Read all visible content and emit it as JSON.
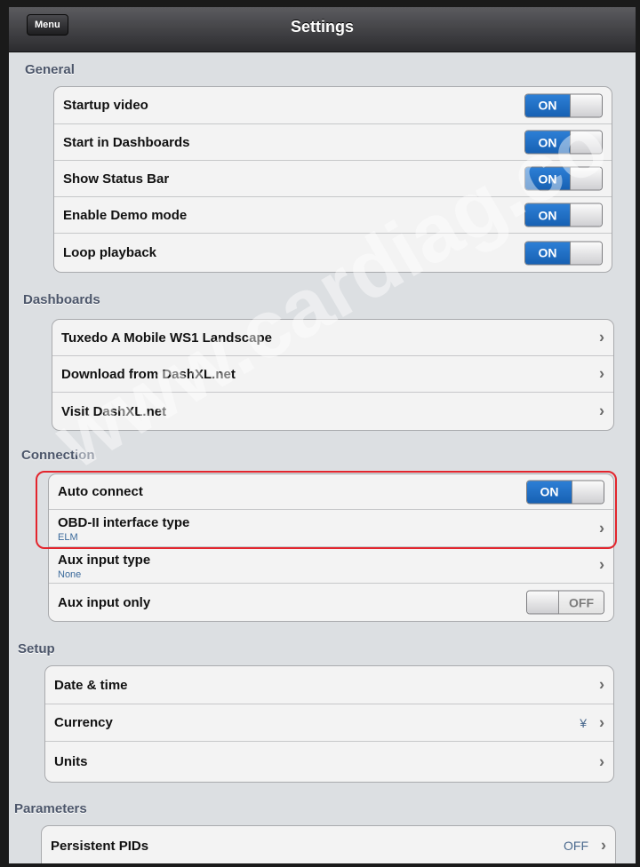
{
  "navbar": {
    "menu_label": "Menu",
    "title": "Settings"
  },
  "sections": {
    "general": {
      "header": "General",
      "rows": [
        {
          "label": "Startup video",
          "toggle": "ON"
        },
        {
          "label": "Start in Dashboards",
          "toggle": "ON"
        },
        {
          "label": "Show Status Bar",
          "toggle": "ON"
        },
        {
          "label": "Enable Demo mode",
          "toggle": "ON"
        },
        {
          "label": "Loop playback",
          "toggle": "ON"
        }
      ]
    },
    "dashboards": {
      "header": "Dashboards",
      "rows": [
        {
          "label": "Tuxedo A Mobile WS1 Landscape"
        },
        {
          "label": "Download from DashXL.net"
        },
        {
          "label": "Visit DashXL.net"
        }
      ]
    },
    "connection": {
      "header": "Connection",
      "rows": [
        {
          "label": "Auto connect",
          "toggle": "ON"
        },
        {
          "label": "OBD-II interface type",
          "sublabel": "ELM"
        },
        {
          "label": "Aux input type",
          "sublabel": "None"
        },
        {
          "label": "Aux input only",
          "toggle": "OFF"
        }
      ]
    },
    "setup": {
      "header": "Setup",
      "rows": [
        {
          "label": "Date & time"
        },
        {
          "label": "Currency",
          "value": "¥"
        },
        {
          "label": "Units"
        }
      ]
    },
    "parameters": {
      "header": "Parameters",
      "rows": [
        {
          "label": "Persistent PIDs",
          "value": "OFF"
        }
      ]
    }
  },
  "watermark": "www.cardiag.co",
  "colors": {
    "toggle_on": "#1f6fc8",
    "highlight": "#e3252d",
    "section_header": "#4c566a"
  },
  "icons": {
    "row_disclosure": "chevron-right-icon"
  }
}
